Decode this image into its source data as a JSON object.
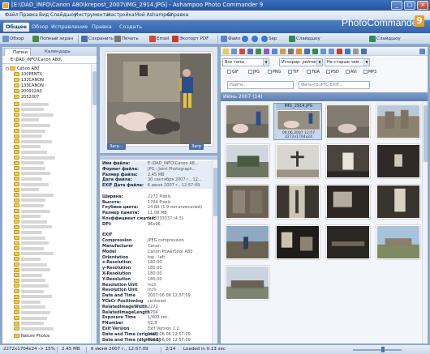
{
  "window": {
    "title": "[E:\\DAD_INFO\\Canon A80\\krepost_2007\\IMG_2914.JPG] - Ashampoo Photo Commander 9",
    "controls": [
      "_",
      "□",
      "×"
    ]
  },
  "menu": [
    "Файл",
    "Правка",
    "Вид",
    "Слайдшоу",
    "Инструменты",
    "Настройка",
    "Мой Ashampoo",
    "Справка"
  ],
  "ribbon": {
    "tabs": [
      "Общее",
      "Обзор",
      "Исправление",
      "Правка",
      "Создать"
    ],
    "toolbar": [
      "Обзор",
      "Полный экран",
      "Сохранить",
      "Печать",
      "Email",
      "Экспорт PDF",
      "Файл",
      "Sep",
      "Слайдшоу",
      "Слайдшоу"
    ]
  },
  "logo": {
    "small": "Ashampoo",
    "main": "PhotoCommander",
    "version": "9"
  },
  "left": {
    "tabs": [
      "Папки",
      "Календарь"
    ],
    "path": "E:\\DAD_INFO\\Canon A80\\",
    "tree": [
      "Canon A80",
      "100PENTX",
      "132CANON",
      "133CANON",
      "200912A0",
      "2052007"
    ],
    "bottom_item": "Nature Photos"
  },
  "preview": {
    "btn_back": "Загр...",
    "btn_forward": "Загр"
  },
  "info": {
    "rows": [
      {
        "k": "Имя файла:",
        "v": "E:\\DAD_INFO\\Canon A8..."
      },
      {
        "k": "Формат файла:",
        "v": "JPG - Joint Photograph..."
      },
      {
        "k": "Размер файла:",
        "v": "2.45 MB"
      },
      {
        "k": "Дата файла:",
        "v": "30 сентября 2007 г., 12..."
      },
      {
        "k": "EXIF Дата файла:",
        "v": "6 июня 2007 г., 12:57:09"
      },
      {
        "k": "",
        "v": ""
      },
      {
        "k": "Ширина:",
        "v": "2272 Pixels"
      },
      {
        "k": "Высота:",
        "v": "1704 Pixels"
      },
      {
        "k": "Глубина цвета:",
        "v": "24 Bit (1.9 мегапикселей)"
      },
      {
        "k": "Размер памяти:",
        "v": "11.08 MB"
      },
      {
        "k": "Коэффициент сжатия:",
        "v": "1.33333337 (4:3)"
      },
      {
        "k": "DPI:",
        "v": "96x96"
      },
      {
        "k": "",
        "v": ""
      },
      {
        "k": "EXIF",
        "v": ""
      },
      {
        "k": "Compression",
        "v": "JPEG compression"
      },
      {
        "k": "Manufacturer",
        "v": "Canon"
      },
      {
        "k": "Model",
        "v": "Canon PowerShot A80"
      },
      {
        "k": "Orientation",
        "v": "top - left"
      },
      {
        "k": "x-Resolution",
        "v": "180.00"
      },
      {
        "k": "y-Resolution",
        "v": "180.00"
      },
      {
        "k": "X-Resolution",
        "v": "180.00"
      },
      {
        "k": "Y-Resolution",
        "v": "180.00"
      },
      {
        "k": "Resolution Unit",
        "v": "Inch"
      },
      {
        "k": "Resolution Unit",
        "v": "Inch"
      },
      {
        "k": "Date and Time",
        "v": "2007:06:06 12:57:09"
      },
      {
        "k": "YCbCr Positioning",
        "v": "centered"
      },
      {
        "k": "RelatedImageWidth",
        "v": "2272"
      },
      {
        "k": "RelatedImageLength",
        "v": "1704"
      },
      {
        "k": "Exposure Time",
        "v": "1/400 sec."
      },
      {
        "k": "FNumber",
        "v": "f/2.8"
      },
      {
        "k": "Exif Version",
        "v": "Exif Version 2.2"
      },
      {
        "k": "Date and Time (original)",
        "v": "2007:06:06 12:57:09"
      },
      {
        "k": "Date and Time (digitized)",
        "v": "2007:06:06 12:57:09"
      }
    ]
  },
  "browser": {
    "combo_type": "Все типы",
    "combo_rating": "Игнорир. рейтин",
    "combo_age": "Не старше чем...",
    "checkboxes": [
      "GIF",
      "JPG",
      "PNG",
      "TIF",
      "TGA",
      "PSD",
      "AVI",
      "MP3"
    ],
    "search_placeholder": "Найти...",
    "iptc_placeholder": "Филь-тр.IPTC/EXIF...",
    "group_title": "Июнь 2007 (14)",
    "selected": {
      "name": "IMG_2914.JPG",
      "date": "06.06.2007 12:57",
      "size": "2272x1704x24"
    }
  },
  "status": {
    "dims": "2272x1704x24 -> 15%",
    "size": "2.45 MB",
    "date": "6 июня 2007 г., 12:57:09",
    "index": "2/14",
    "loaded": "Loaded in 0.13 sec"
  }
}
